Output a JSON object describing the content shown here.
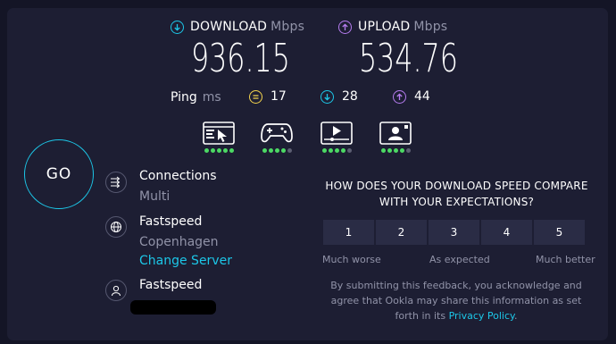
{
  "download": {
    "label": "DOWNLOAD",
    "unit": "Mbps",
    "value": "936.15",
    "icon": "arrow-down-circle-icon",
    "color": "#1cc7e8"
  },
  "upload": {
    "label": "UPLOAD",
    "unit": "Mbps",
    "value": "534.76",
    "icon": "arrow-up-circle-icon",
    "color": "#b67cf0"
  },
  "ping": {
    "label": "Ping",
    "unit": "ms",
    "idle": {
      "value": "17",
      "color": "#f4d44d",
      "icon": "idle-latency-icon"
    },
    "download": {
      "value": "28",
      "color": "#1cc7e8",
      "icon": "download-latency-icon"
    },
    "upload": {
      "value": "44",
      "color": "#b67cf0",
      "icon": "upload-latency-icon"
    }
  },
  "activities": [
    {
      "name": "web-browsing-icon",
      "rating": 5
    },
    {
      "name": "gaming-icon",
      "rating": 4
    },
    {
      "name": "video-streaming-icon",
      "rating": 4
    },
    {
      "name": "video-chat-icon",
      "rating": 4
    }
  ],
  "go_label": "GO",
  "connections": {
    "title": "Connections",
    "value": "Multi"
  },
  "server": {
    "title": "Fastspeed",
    "location": "Copenhagen",
    "change_label": "Change Server"
  },
  "provider": {
    "title": "Fastspeed"
  },
  "feedback": {
    "question_line1": "HOW DOES YOUR DOWNLOAD SPEED COMPARE",
    "question_line2": "WITH YOUR EXPECTATIONS?",
    "options": [
      "1",
      "2",
      "3",
      "4",
      "5"
    ],
    "scale_low": "Much worse",
    "scale_mid": "As expected",
    "scale_high": "Much better",
    "note_line1": "By submitting this feedback, you acknowledge and",
    "note_line2": "agree that Ookla may share this information as set",
    "note_line3_prefix": "forth in its",
    "privacy_link": "Privacy Policy",
    "note_suffix": "."
  },
  "colors": {
    "background": "#1d1e33",
    "accent": "#1cc7e8",
    "good": "#4cd964"
  }
}
